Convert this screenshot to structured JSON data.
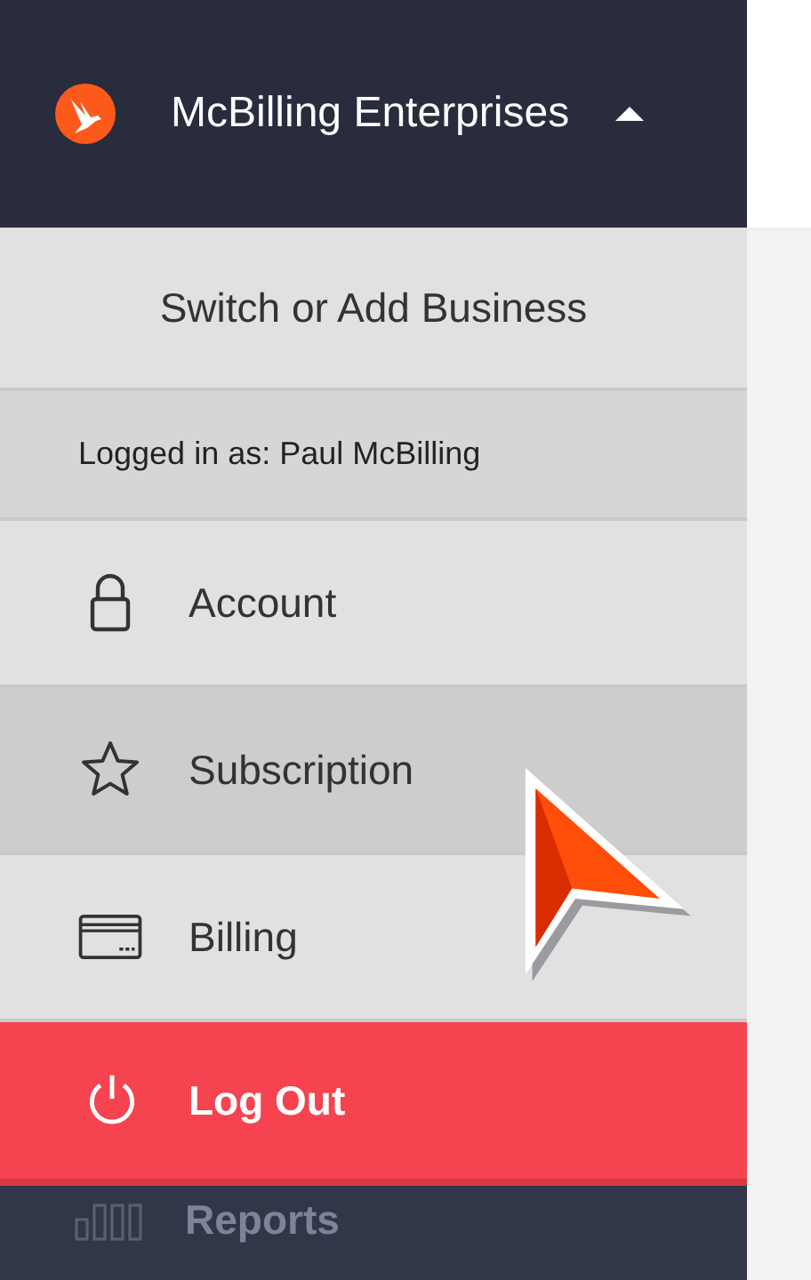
{
  "header": {
    "business_name": "McBilling Enterprises",
    "expanded": true
  },
  "menu": [
    {
      "kind": "action",
      "label": "Switch or Add Business"
    },
    {
      "kind": "info",
      "label": "Logged in as: Paul McBilling"
    },
    {
      "kind": "link",
      "label": "Account",
      "selected": false
    },
    {
      "kind": "link",
      "label": "Subscription",
      "selected": true
    },
    {
      "kind": "link",
      "label": "Billing",
      "selected": false
    },
    {
      "kind": "danger",
      "label": "Log Out"
    }
  ],
  "sidebar": {
    "items": [
      {
        "label": "Reports"
      }
    ]
  }
}
